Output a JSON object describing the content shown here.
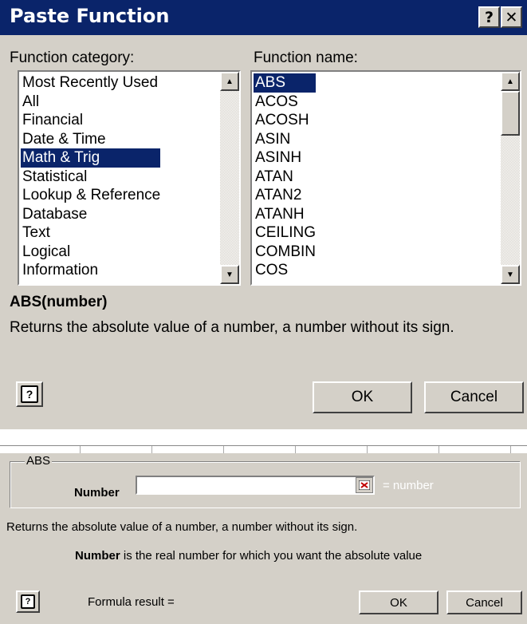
{
  "paste_function": {
    "title": "Paste Function",
    "help_glyph": "?",
    "close_glyph": "✕",
    "category_label": "Function category:",
    "name_label": "Function name:",
    "categories": [
      "Most Recently Used",
      "All",
      "Financial",
      "Date & Time",
      "Math & Trig",
      "Statistical",
      "Lookup & Reference",
      "Database",
      "Text",
      "Logical",
      "Information"
    ],
    "selected_category": "Math & Trig",
    "functions": [
      "ABS",
      "ACOS",
      "ACOSH",
      "ASIN",
      "ASINH",
      "ATAN",
      "ATAN2",
      "ATANH",
      "CEILING",
      "COMBIN",
      "COS"
    ],
    "selected_function": "ABS",
    "signature": "ABS(number)",
    "description": "Returns the absolute value of a number, a number without its sign.",
    "ok_label": "OK",
    "cancel_label": "Cancel",
    "help_icon_glyph": "?"
  },
  "formula_palette": {
    "group_title": "ABS",
    "arg_label": "Number",
    "arg_value": "",
    "arg_result": "= number",
    "description": "Returns the absolute value of a number, a number without its sign.",
    "arg_help_bold": "Number",
    "arg_help": " is the real number for which you want the absolute value",
    "formula_result": "Formula result =",
    "ok_label": "OK",
    "cancel_label": "Cancel",
    "help_icon_glyph": "?"
  },
  "colors": {
    "titlebar": "#0a246a",
    "selection": "#0a246a",
    "face": "#d4d0c8"
  }
}
